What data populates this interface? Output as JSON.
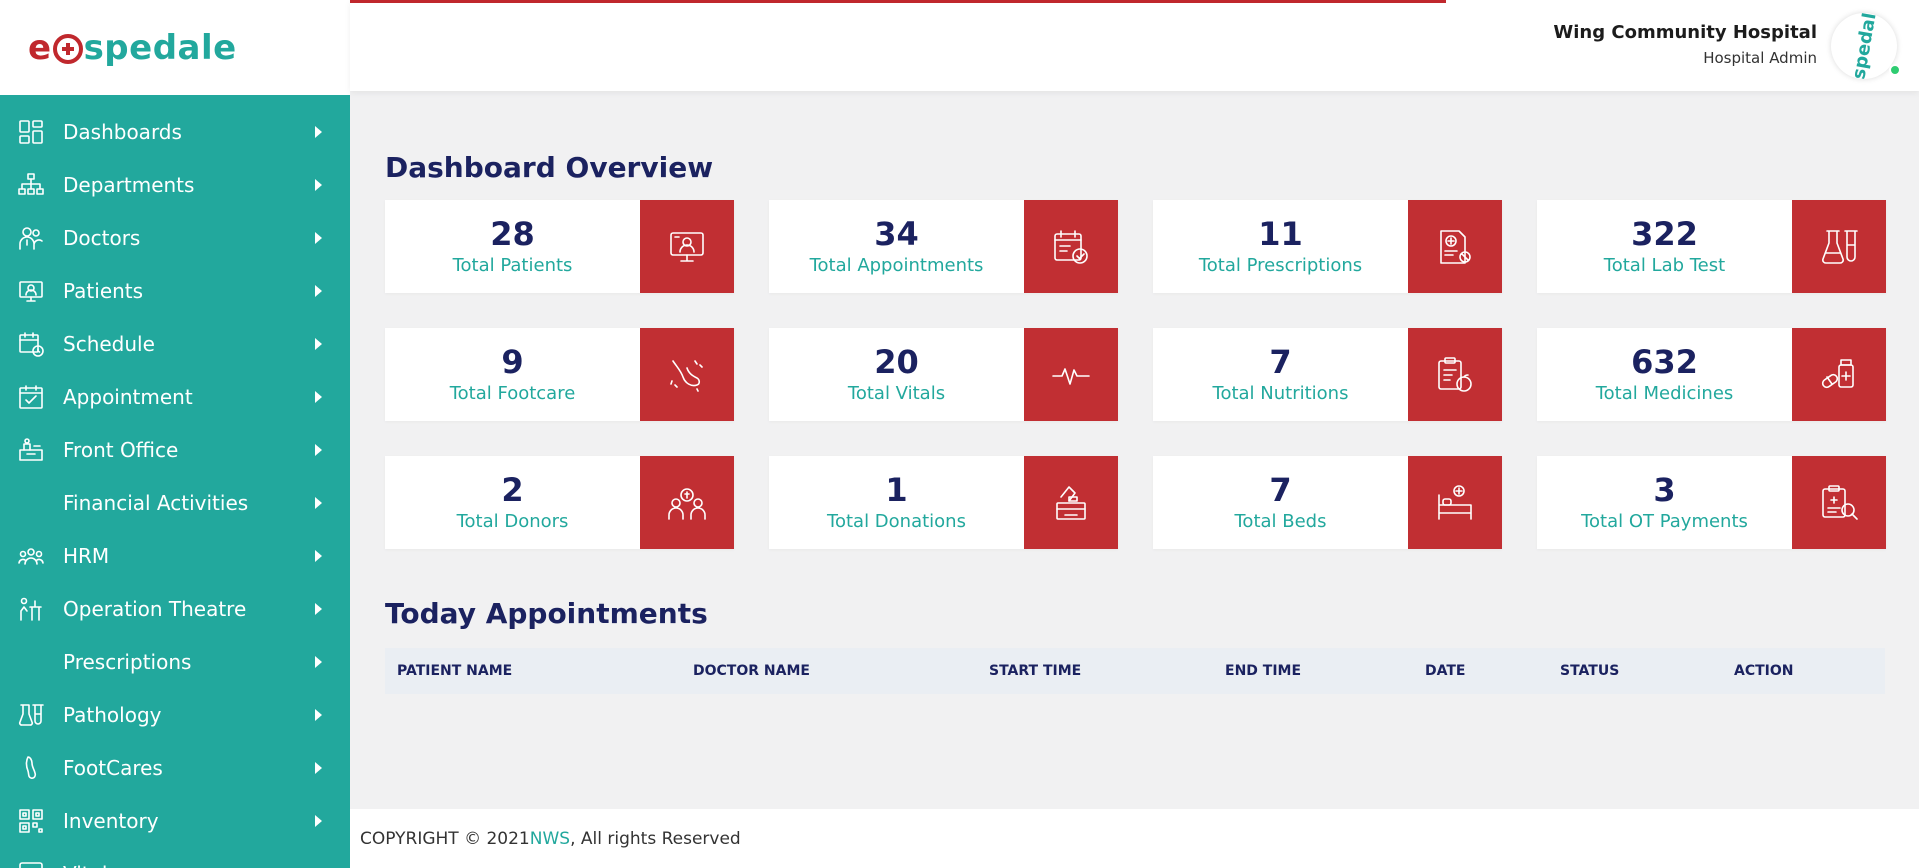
{
  "brand": {
    "logo_text_pre": "e",
    "logo_text_post": "spedale"
  },
  "colors": {
    "primary": "#22a89d",
    "accent": "#c12f33",
    "navy": "#1b2260"
  },
  "sidebar": {
    "items": [
      {
        "label": "Dashboards",
        "icon": "dashboard-icon"
      },
      {
        "label": "Departments",
        "icon": "department-icon"
      },
      {
        "label": "Doctors",
        "icon": "doctor-icon"
      },
      {
        "label": "Patients",
        "icon": "patient-icon"
      },
      {
        "label": "Schedule",
        "icon": "schedule-icon"
      },
      {
        "label": "Appointment",
        "icon": "appointment-icon"
      },
      {
        "label": "Front Office",
        "icon": "front-office-icon"
      },
      {
        "label": "Financial Activities",
        "icon": ""
      },
      {
        "label": "HRM",
        "icon": "hrm-icon"
      },
      {
        "label": "Operation Theatre",
        "icon": "operation-icon"
      },
      {
        "label": "Prescriptions",
        "icon": ""
      },
      {
        "label": "Pathology",
        "icon": "pathology-icon"
      },
      {
        "label": "FootCares",
        "icon": "footcare-icon"
      },
      {
        "label": "Inventory",
        "icon": "inventory-icon"
      },
      {
        "label": "Vitals",
        "icon": "vitals-icon"
      }
    ]
  },
  "header": {
    "hospital_name": "Wing Community Hospital",
    "user_role": "Hospital Admin",
    "avatar_text_pre": "e",
    "avatar_text_post": "spedale"
  },
  "overview": {
    "title": "Dashboard Overview",
    "cards": [
      {
        "value": "28",
        "label": "Total Patients",
        "icon": "patient-monitor-icon"
      },
      {
        "value": "34",
        "label": "Total Appointments",
        "icon": "calendar-check-icon"
      },
      {
        "value": "11",
        "label": "Total Prescriptions",
        "icon": "prescription-icon"
      },
      {
        "value": "322",
        "label": "Total Lab Test",
        "icon": "lab-flask-icon"
      },
      {
        "value": "9",
        "label": "Total Footcare",
        "icon": "foot-icon"
      },
      {
        "value": "20",
        "label": "Total Vitals",
        "icon": "heartbeat-icon"
      },
      {
        "value": "7",
        "label": "Total Nutritions",
        "icon": "nutrition-icon"
      },
      {
        "value": "632",
        "label": "Total Medicines",
        "icon": "medicine-icon"
      },
      {
        "value": "2",
        "label": "Total Donors",
        "icon": "donor-icon"
      },
      {
        "value": "1",
        "label": "Total Donations",
        "icon": "donation-box-icon"
      },
      {
        "value": "7",
        "label": "Total Beds",
        "icon": "bed-icon"
      },
      {
        "value": "3",
        "label": "Total OT Payments",
        "icon": "ot-payment-icon"
      }
    ]
  },
  "appointments": {
    "title": "Today Appointments",
    "columns": [
      "PATIENT NAME",
      "DOCTOR NAME",
      "START TIME",
      "END TIME",
      "DATE",
      "STATUS",
      "ACTION"
    ]
  },
  "footer": {
    "prefix": "COPYRIGHT © 2021 ",
    "company": "NWS",
    "suffix": ", All rights Reserved"
  }
}
